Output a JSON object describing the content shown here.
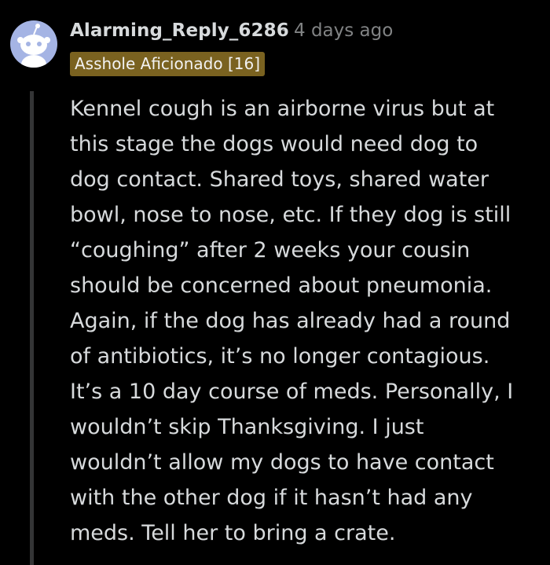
{
  "comment": {
    "author": "Alarming_Reply_6286",
    "separator": "·",
    "timestamp": "4 days ago",
    "flair": "Asshole Aficionado [16]",
    "avatar_icon": "snoo-avatar-icon",
    "body_lines": [
      "Kennel cough is an airborne virus but at",
      "this stage the dogs would need dog to",
      "dog contact. Shared toys, shared water",
      "bowl, nose to nose, etc. If they dog is still",
      "“coughing” after 2 weeks your cousin",
      "should be concerned about pneumonia.",
      "Again, if the dog has already had a round",
      "of antibiotics, it’s no longer contagious.",
      "It’s a 10 day course of meds. Personally, I",
      "wouldn’t skip Thanksgiving. I just",
      "wouldn’t allow my dogs to have contact",
      "with the other dog if it hasn’t had any",
      "meds. Tell her to bring a crate."
    ]
  },
  "colors": {
    "background": "#000000",
    "text": "#d7dadc",
    "meta": "#818384",
    "flair_bg": "#7a6220",
    "avatar_bg": "#a5b4e4",
    "thread_line": "#343536"
  }
}
